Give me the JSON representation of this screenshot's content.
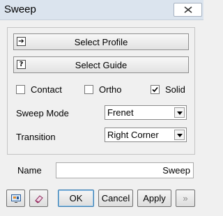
{
  "window": {
    "title": "Sweep"
  },
  "buttons": {
    "select_profile": "Select Profile",
    "select_guide": "Select Guide",
    "ok": "OK",
    "cancel": "Cancel",
    "apply": "Apply",
    "more": "»"
  },
  "icons": {
    "profile_icon": "➔",
    "guide_icon": "?"
  },
  "checkboxes": [
    {
      "label": "Contact",
      "checked": false
    },
    {
      "label": "Ortho",
      "checked": false
    },
    {
      "label": "Solid",
      "checked": true
    }
  ],
  "fields": {
    "sweep_mode_label": "Sweep Mode",
    "sweep_mode_value": "Frenet",
    "transition_label": "Transition",
    "transition_value": "Right Corner",
    "name_label": "Name",
    "name_value": "Sweep"
  },
  "colors": {
    "accent": "#3c7fb1"
  }
}
